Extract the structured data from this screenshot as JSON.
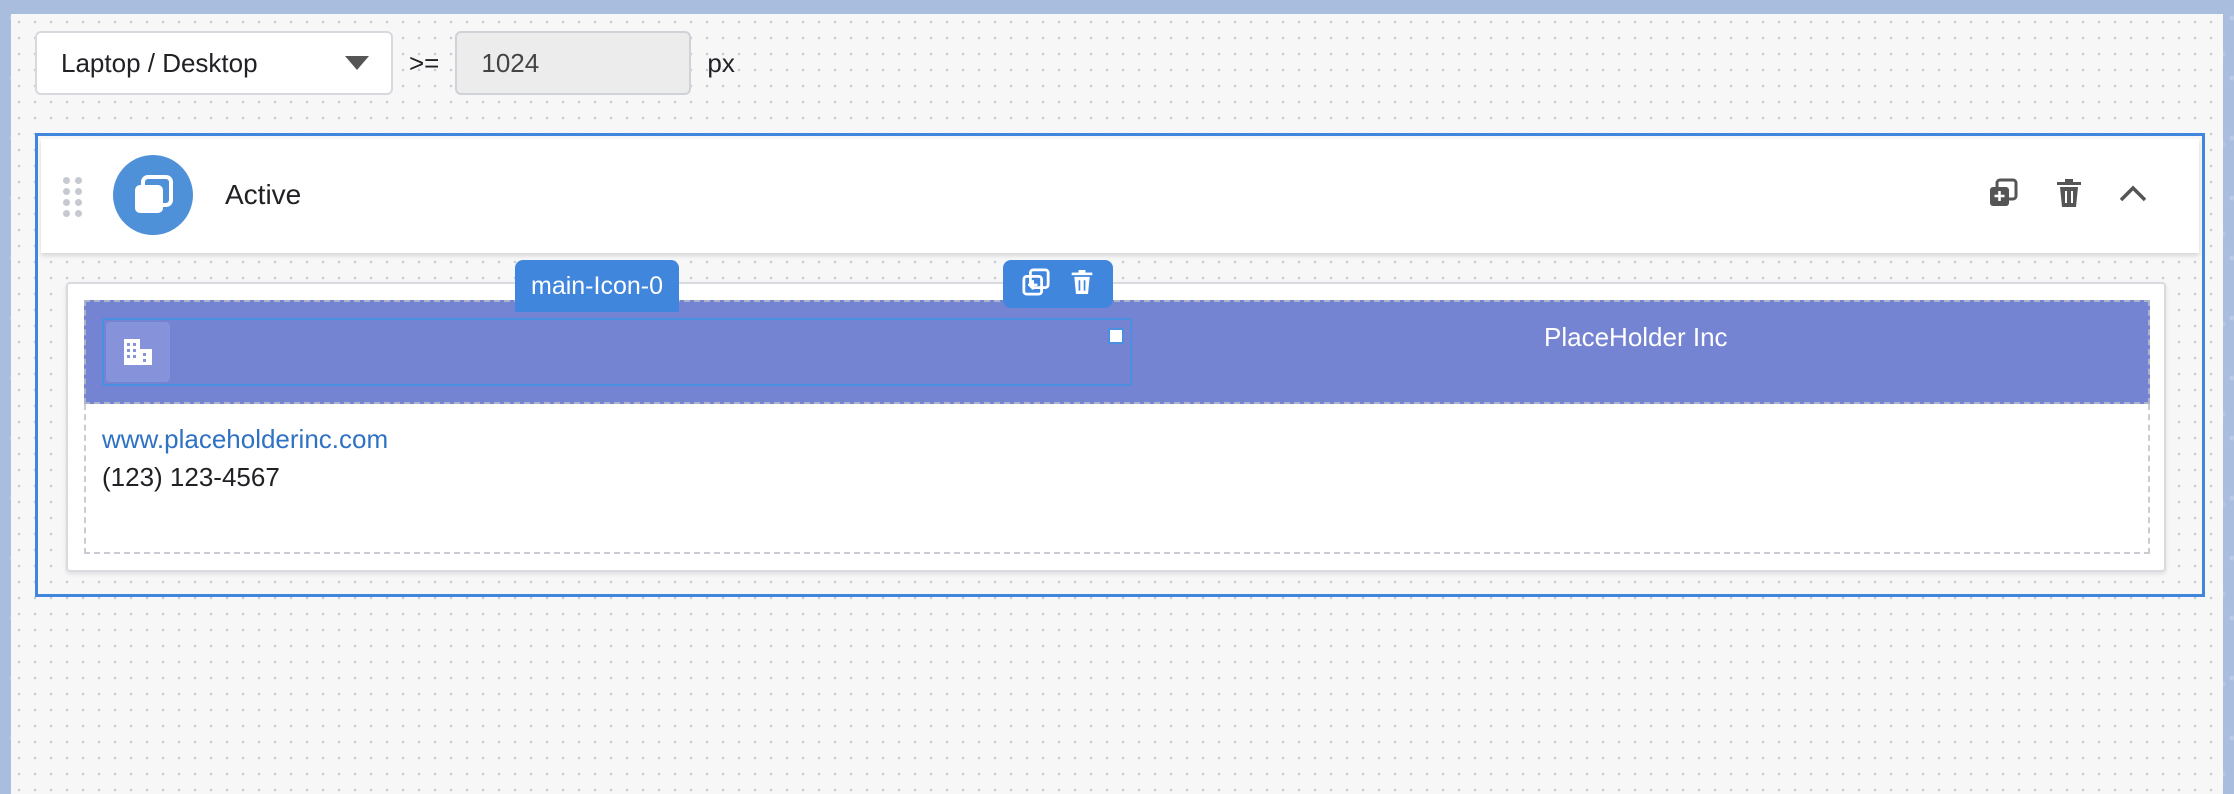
{
  "toolbar": {
    "device_select": "Laptop / Desktop",
    "operator": ">=",
    "breakpoint_value": "1024",
    "unit": "px"
  },
  "panel": {
    "title": "Active",
    "icons": {
      "drag": "drag-handle-icon",
      "avatar": "copy-icon",
      "duplicate": "duplicate-icon",
      "delete": "trash-icon",
      "collapse": "chevron-up-icon"
    }
  },
  "element_tag": {
    "label": "main-Icon-0"
  },
  "card": {
    "company_name": "PlaceHolder Inc",
    "website": "www.placeholderinc.com",
    "phone": "(123) 123-4567"
  },
  "colors": {
    "accent": "#3f86dc",
    "banner": "#7583d3",
    "link": "#2f72c4"
  }
}
